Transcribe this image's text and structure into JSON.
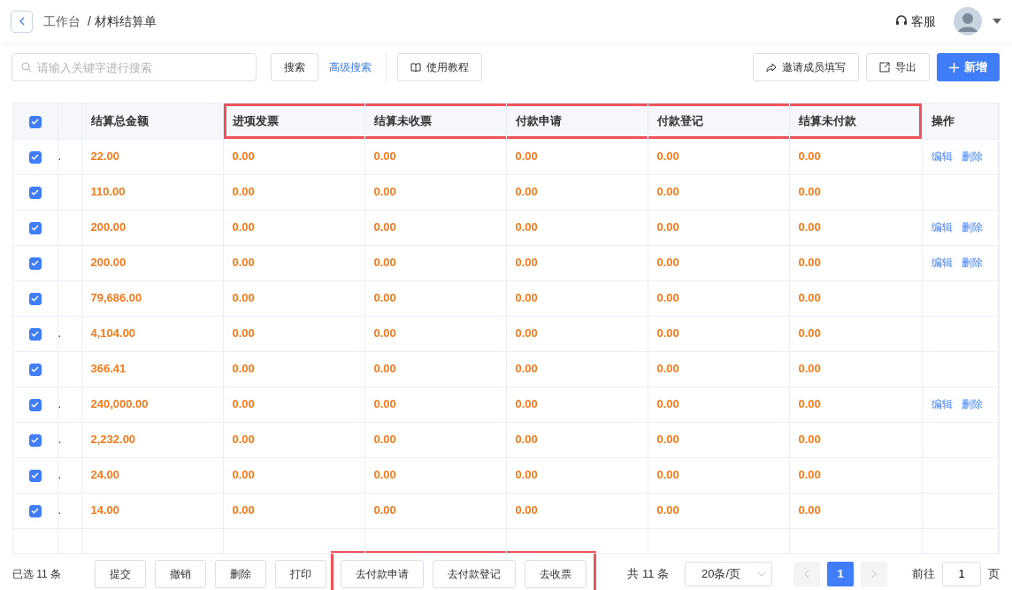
{
  "header": {
    "breadcrumb_home": "工作台",
    "breadcrumb_current": "/ 材料结算单",
    "service_label": "客服"
  },
  "toolbar": {
    "search_placeholder": "请输入关键字进行搜索",
    "search_button": "搜索",
    "advanced_link": "高级搜索",
    "tutorial_button": "使用教程",
    "invite_button": "邀请成员填写",
    "export_button": "导出",
    "add_button": "新增"
  },
  "table": {
    "select_all_checked": true,
    "columns": [
      {
        "label": "结算总金额",
        "highlighted": false
      },
      {
        "label": "进项发票",
        "highlighted": true
      },
      {
        "label": "结算未收票",
        "highlighted": true
      },
      {
        "label": "付款申请",
        "highlighted": true
      },
      {
        "label": "付款登记",
        "highlighted": true
      },
      {
        "label": "结算未付款",
        "highlighted": true
      },
      {
        "label": "操作",
        "highlighted": false
      }
    ],
    "rows": [
      {
        "checked": true,
        "column_2": ".",
        "amount": "22.00",
        "values": [
          "0.00",
          "0.00",
          "0.00",
          "0.00",
          "0.00"
        ],
        "actions": [
          "编辑",
          "删除"
        ]
      },
      {
        "checked": true,
        "amount": "110.00",
        "values": [
          "0.00",
          "0.00",
          "0.00",
          "0.00",
          "0.00"
        ]
      },
      {
        "checked": true,
        "amount": "200.00",
        "values": [
          "0.00",
          "0.00",
          "0.00",
          "0.00",
          "0.00"
        ],
        "actions": [
          "编辑",
          "删除"
        ]
      },
      {
        "checked": true,
        "amount": "200.00",
        "values": [
          "0.00",
          "0.00",
          "0.00",
          "0.00",
          "0.00"
        ],
        "actions": [
          "编辑",
          "删除"
        ]
      },
      {
        "checked": true,
        "amount": "79,686.00",
        "values": [
          "0.00",
          "0.00",
          "0.00",
          "0.00",
          "0.00"
        ]
      },
      {
        "checked": true,
        "column_2": ".",
        "amount": "4,104.00",
        "values": [
          "0.00",
          "0.00",
          "0.00",
          "0.00",
          "0.00"
        ]
      },
      {
        "checked": true,
        "amount": "366.41",
        "values": [
          "0.00",
          "0.00",
          "0.00",
          "0.00",
          "0.00"
        ]
      },
      {
        "checked": true,
        "column_2": ".",
        "amount": "240,000.00",
        "values": [
          "0.00",
          "0.00",
          "0.00",
          "0.00",
          "0.00"
        ],
        "actions": [
          "编辑",
          "删除"
        ]
      },
      {
        "checked": true,
        "column_2": ".",
        "amount": "2,232.00",
        "values": [
          "0.00",
          "0.00",
          "0.00",
          "0.00",
          "0.00"
        ]
      },
      {
        "checked": true,
        "column_2": ".",
        "amount": "24.00",
        "values": [
          "0.00",
          "0.00",
          "0.00",
          "0.00",
          "0.00"
        ]
      },
      {
        "checked": true,
        "column_2": ".",
        "amount": "14.00",
        "values": [
          "0.00",
          "0.00",
          "0.00",
          "0.00",
          "0.00"
        ]
      }
    ]
  },
  "footer": {
    "selected_count": "已选 11 条",
    "buttons": [
      {
        "label": "提交",
        "highlighted": false
      },
      {
        "label": "撤销",
        "highlighted": false
      },
      {
        "label": "删除",
        "highlighted": false
      },
      {
        "label": "打印",
        "highlighted": false
      },
      {
        "label": "去付款申请",
        "highlighted": true
      },
      {
        "label": "去付款登记",
        "highlighted": true
      },
      {
        "label": "去收票",
        "highlighted": true
      }
    ],
    "total": "共 11 条",
    "page_size": "20条/页",
    "pages": [
      {
        "label": "1",
        "selected": true
      }
    ],
    "goto_label": "前往",
    "goto_value": "1",
    "goto_suffix": "页"
  }
}
